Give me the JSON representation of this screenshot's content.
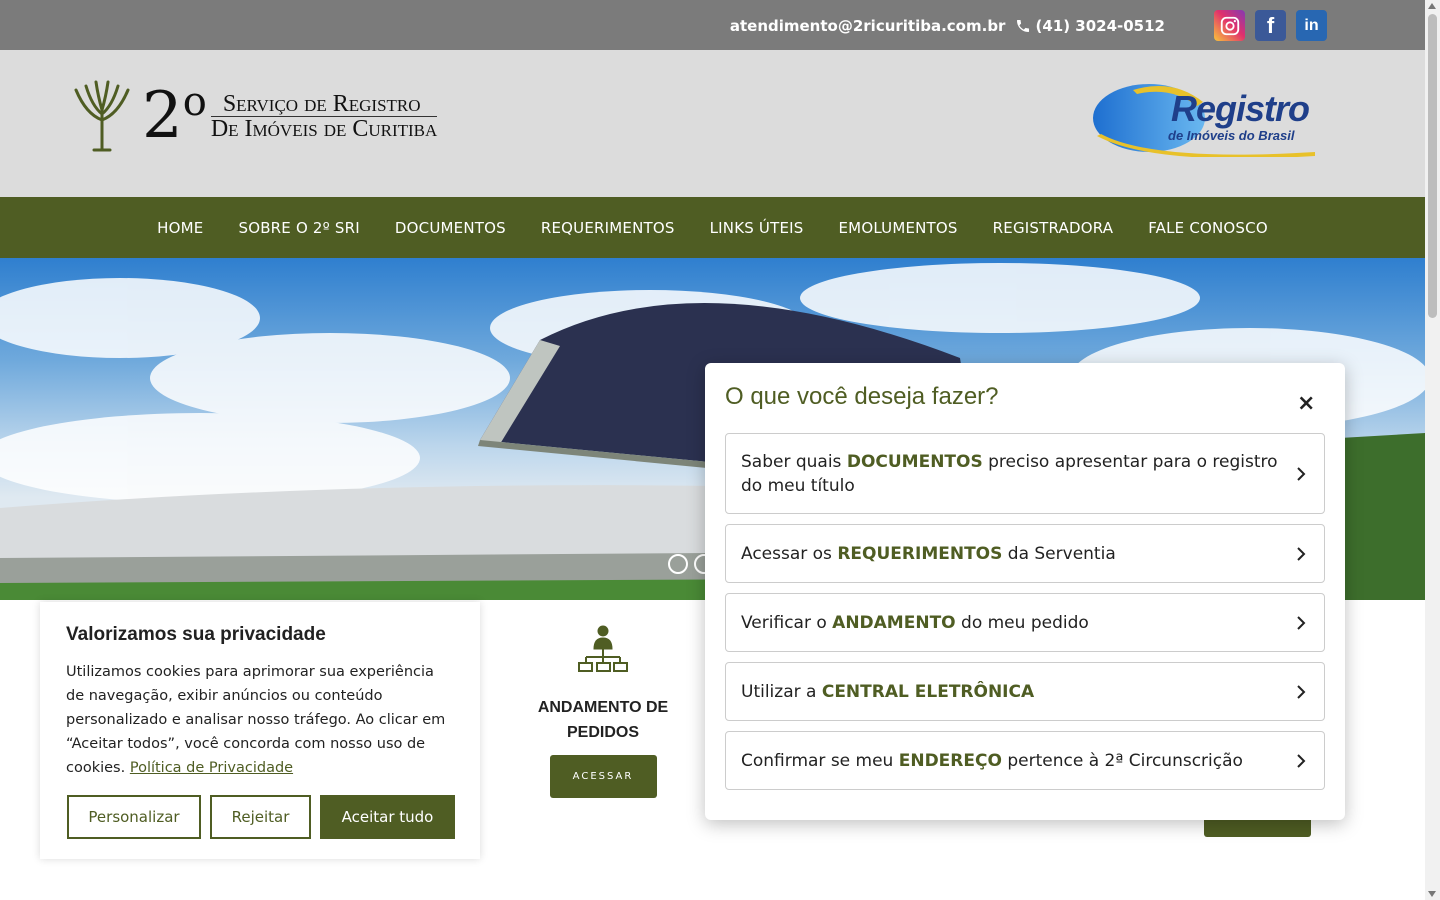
{
  "topbar": {
    "email": "atendimento@2ricuritiba.com.br",
    "phone": "(41) 3024-0512",
    "social": [
      "instagram-icon",
      "facebook-icon",
      "linkedin-icon"
    ],
    "facebook_glyph": "f",
    "linkedin_glyph": "in"
  },
  "header": {
    "logo_number": "2",
    "logo_superscript": "o",
    "logo_line1": "Serviço de Registro",
    "logo_line2": "De Imóveis de Curitiba",
    "rib_title": "Registro",
    "rib_subtitle": "de Imóveis do Brasil"
  },
  "nav": {
    "items": [
      {
        "label": "HOME"
      },
      {
        "label": "SOBRE O 2º SRI"
      },
      {
        "label": "DOCUMENTOS"
      },
      {
        "label": "REQUERIMENTOS"
      },
      {
        "label": "LINKS ÚTEIS"
      },
      {
        "label": "EMOLUMENTOS"
      },
      {
        "label": "REGISTRADORA"
      },
      {
        "label": "FALE CONOSCO"
      }
    ]
  },
  "feature": {
    "title": "ANDAMENTO DE PEDIDOS",
    "button": "ACESSAR"
  },
  "cookie": {
    "title": "Valorizamos sua privacidade",
    "text": "Utilizamos cookies para aprimorar sua experiência de navegação, exibir anúncios ou conteúdo personalizado e analisar nosso tráfego. Ao clicar em “Aceitar todos”, você concorda com nosso uso de cookies.",
    "link": "Política de Privacidade",
    "customize": "Personalizar",
    "reject": "Rejeitar",
    "accept": "Aceitar tudo"
  },
  "modal": {
    "title": "O que você deseja fazer?",
    "close": "×",
    "options": [
      {
        "pre": "Saber quais ",
        "key": "DOCUMENTOS",
        "post": " preciso apresentar para o registro do meu título"
      },
      {
        "pre": "Acessar os ",
        "key": "REQUERIMENTOS",
        "post": " da Serventia"
      },
      {
        "pre": "Verificar o ",
        "key": "ANDAMENTO",
        "post": " do meu pedido"
      },
      {
        "pre": "Utilizar a ",
        "key": "CENTRAL ELETRÔNICA",
        "post": ""
      },
      {
        "pre": "Confirmar se meu ",
        "key": "ENDEREÇO",
        "post": " pertence à 2ª Circunscrição"
      }
    ]
  },
  "colors": {
    "brand_green": "#4f5d23",
    "topbar_gray": "#7b7b7b",
    "header_gray": "#dcdcdc"
  }
}
